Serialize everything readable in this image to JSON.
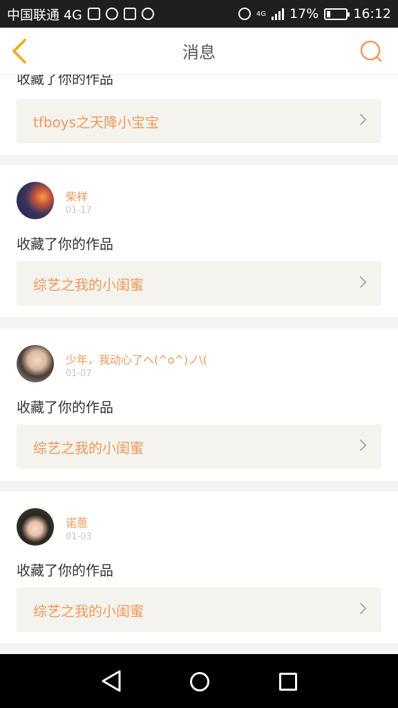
{
  "status_bar": {
    "carrier": "中国联通 4G",
    "network_badge": "4G",
    "battery_percent": "17%",
    "time": "16:12",
    "icons": [
      "image-icon",
      "vpn-icon",
      "keyboard-icon",
      "app-icon",
      "alarm-icon",
      "signal-icon",
      "battery-icon"
    ]
  },
  "header": {
    "title": "消息",
    "back_icon": "chevron-left-icon",
    "search_icon": "search-icon",
    "accent_color": "#f0985a"
  },
  "messages": [
    {
      "action": "收藏了你的作品",
      "work_title": "tfboys之天降小宝宝"
    },
    {
      "username": "柴祥",
      "date": "01-17",
      "action": "收藏了你的作品",
      "work_title": "综艺之我的小闺蜜"
    },
    {
      "username": "少年，我动心了へ(^o^)ノ\\(",
      "date": "01-07",
      "action": "收藏了你的作品",
      "work_title": "综艺之我的小闺蜜"
    },
    {
      "username": "诺蒽",
      "date": "01-03",
      "action": "收藏了你的作品",
      "work_title": "综艺之我的小闺蜜"
    }
  ],
  "system_nav": {
    "icons": [
      "triangle-back-icon",
      "circle-home-icon",
      "square-recents-icon"
    ]
  }
}
